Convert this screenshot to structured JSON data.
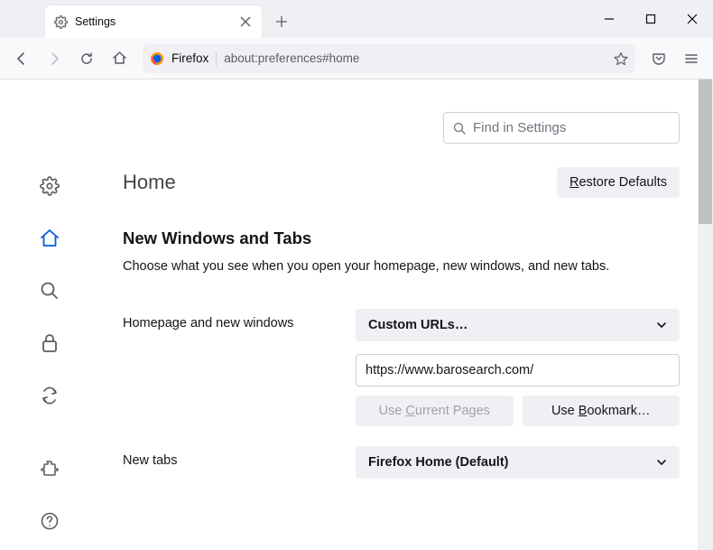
{
  "tab": {
    "title": "Settings"
  },
  "urlbar": {
    "brand": "Firefox",
    "url": "about:preferences#home"
  },
  "search": {
    "placeholder": "Find in Settings"
  },
  "page": {
    "title": "Home",
    "restore_defaults": "Restore Defaults",
    "section_title": "New Windows and Tabs",
    "section_desc": "Choose what you see when you open your homepage, new windows, and new tabs."
  },
  "form": {
    "homepage_label": "Homepage and new windows",
    "homepage_select": "Custom URLs…",
    "homepage_url": "https://www.barosearch.com/",
    "use_current": "Use Current Pages",
    "use_bookmark": "Use Bookmark…",
    "newtabs_label": "New tabs",
    "newtabs_select": "Firefox Home (Default)"
  }
}
